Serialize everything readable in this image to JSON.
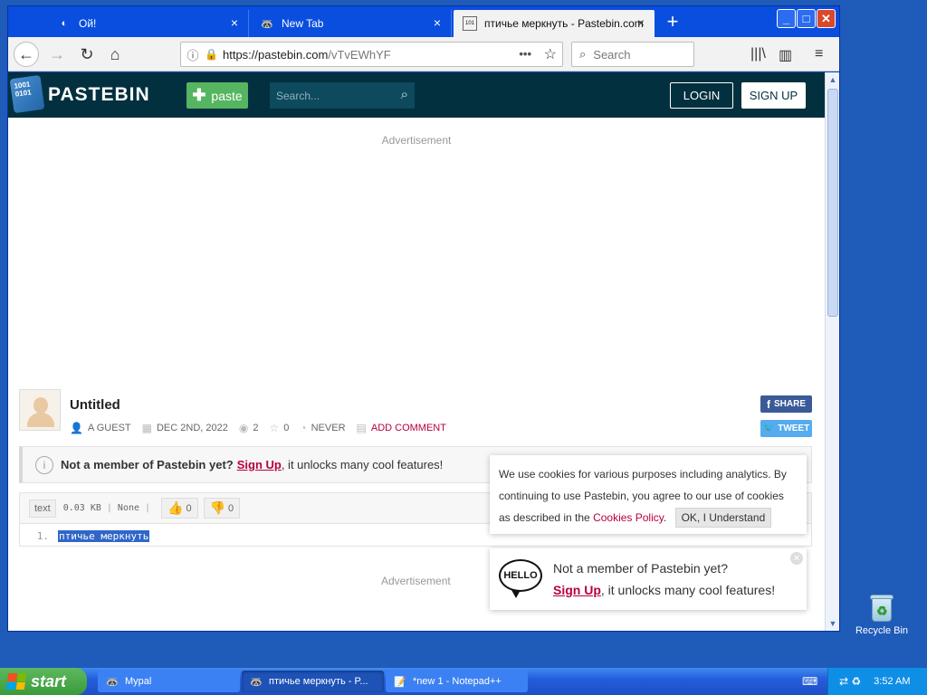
{
  "browser": {
    "tabs": [
      {
        "title": "Ой!",
        "icon": "blue-swirl-icon",
        "active": false
      },
      {
        "title": "New Tab",
        "icon": "raccoon-icon",
        "active": false
      },
      {
        "title": "птичье меркнуть - Pastebin.com",
        "icon": "pastebin-icon",
        "active": true
      }
    ],
    "url_host": "https://pastebin.com",
    "url_path": "/vTvEWhYF",
    "search_placeholder": "Search"
  },
  "pastebin": {
    "logo_text": "PASTEBIN",
    "logo_mark": "1001 0101",
    "paste_button": "paste",
    "search_placeholder": "Search...",
    "login": "LOGIN",
    "signup": "SIGN UP",
    "ad_label_top": "Advertisement",
    "ad_label_bottom": "Advertisement",
    "paste": {
      "title": "Untitled",
      "author": "A GUEST",
      "date": "DEC 2ND, 2022",
      "views": "2",
      "stars": "0",
      "expires": "NEVER",
      "add_comment": "ADD COMMENT",
      "share": "SHARE",
      "tweet": "TWEET"
    },
    "notice": {
      "bold": "Not a member of Pastebin yet?",
      "link": "Sign Up",
      "rest": ", it unlocks many cool features!"
    },
    "code": {
      "language": "text",
      "size": "0.03 KB",
      "category": "None",
      "likes": "0",
      "dislikes": "0",
      "line_number": "1.",
      "line_text": "птичье меркнуть"
    },
    "cookie": {
      "text_before": "We use cookies for various purposes including analytics. By continuing to use Pastebin, you agree to our use of cookies as described in the ",
      "link": "Cookies Policy",
      "text_after": ".",
      "button": "OK, I Understand"
    },
    "hello": {
      "bubble": "HELLO",
      "line1": "Not a member of Pastebin yet?",
      "link": "Sign Up",
      "line2_rest": ", it unlocks many cool features!"
    }
  },
  "desktop": {
    "recycle_bin": "Recycle Bin"
  },
  "taskbar": {
    "start": "start",
    "tasks": [
      {
        "title": "Mypal",
        "icon": "raccoon-icon"
      },
      {
        "title": "птичье меркнуть - P...",
        "icon": "raccoon-icon"
      },
      {
        "title": "*new 1 - Notepad++",
        "icon": "notepad-icon"
      }
    ],
    "clock": "3:52 AM"
  },
  "colors": {
    "pastebin_header": "#02303e",
    "paste_green": "#56b560",
    "link_red": "#b8003a",
    "xp_blue": "#245edb"
  }
}
